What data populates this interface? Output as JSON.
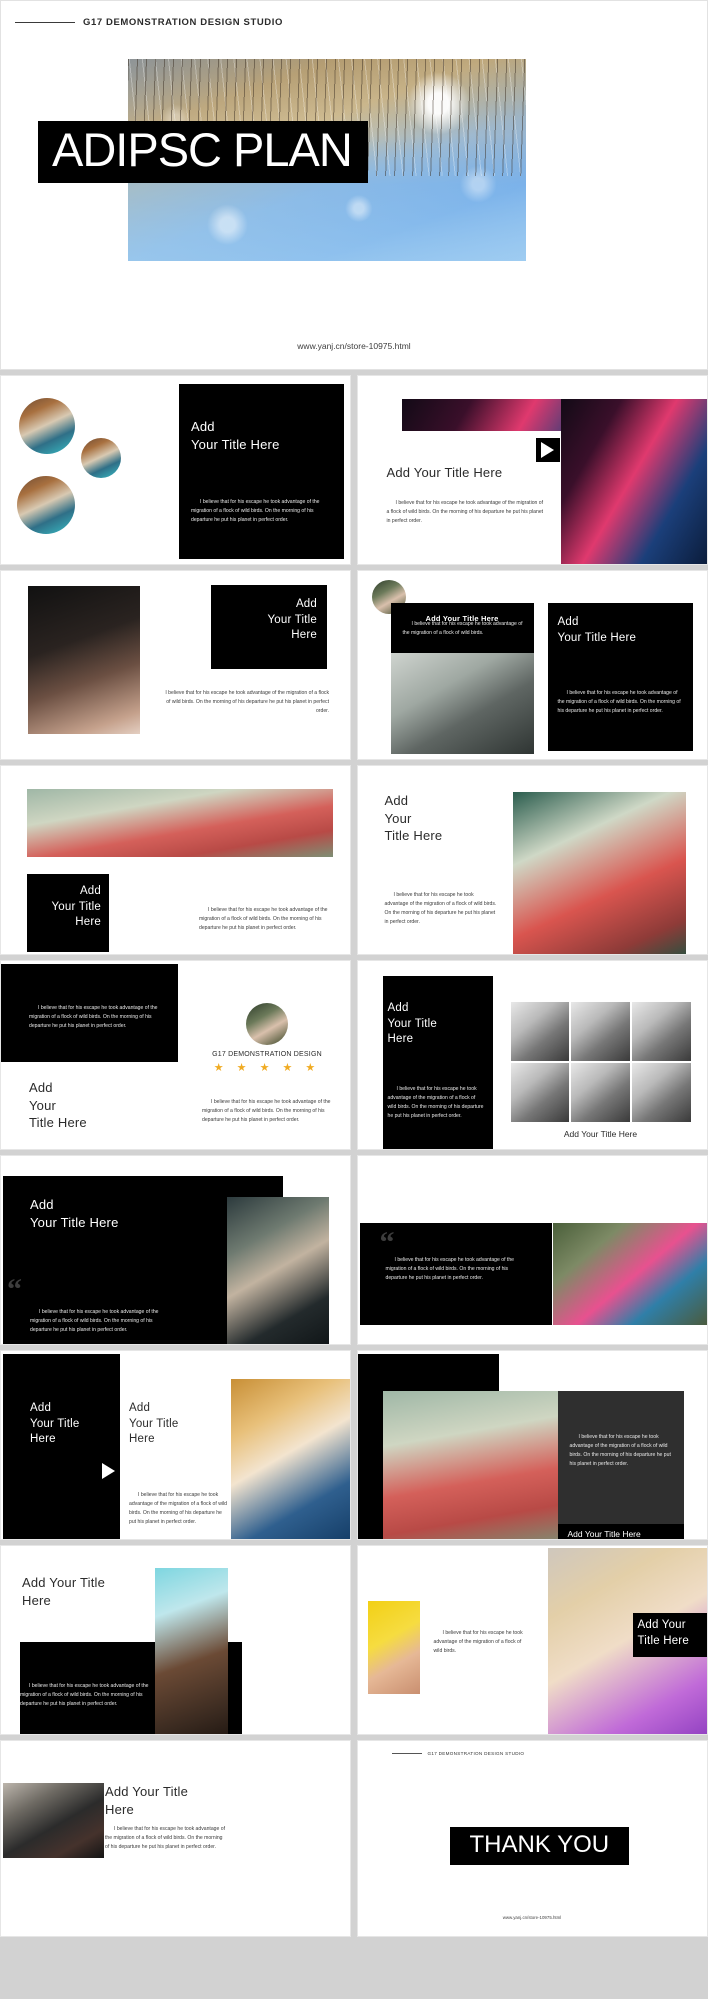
{
  "cover": {
    "brand": "G17 DEMONSTRATION  DESIGN STUDIO",
    "title": "ADIPSC PLAN",
    "url": "www.yanj.cn/store-10975.html"
  },
  "common": {
    "title_full": "Add Your Title Here",
    "title_line1": "Add",
    "title_line2": "Your Title Here",
    "title_l1": "Add",
    "title_l2": "Your",
    "title_l3": "Title Here",
    "body_full": "I believe that for his escape he took advantage of the migration of a flock of wild birds. On the morning of his departure he put his planet in perfect order.",
    "body_short": "I believe that for his escape he took advantage of the  migration of a flock of wild birds.",
    "quote_glyph": "“",
    "play_icon": "play-icon"
  },
  "slides": [
    {
      "id": "circles-photos",
      "title_line1": "Add",
      "title_line2": "Your Title Here",
      "body": "I believe that for his escape he took advantage of the migration of a flock of wild birds. On the morning of his departure he put his planet in perfect order."
    },
    {
      "id": "video-banner",
      "title": "Add Your Title Here",
      "body": "I believe that for his escape he took advantage of the migration of a flock of wild birds. On the morning of his departure he put his planet in perfect order."
    },
    {
      "id": "dark-portrait-right-title",
      "title_l1": "Add",
      "title_l2": "Your Title",
      "title_l3": "Here",
      "body": "I believe that for his escape he took advantage of the migration of a flock of wild birds. On the morning of his departure he put his planet in perfect order."
    },
    {
      "id": "avatar-card-street",
      "card_title": "Add Your Title Here",
      "card_body": "I believe that for his escape he took advantage of the  migration of a flock of wild birds.",
      "title_line1": "Add",
      "title_line2": "Your Title Here",
      "body": "I believe that for his escape he took advantage of the migration of a flock of wild birds. On the morning of his departure he put his planet in perfect order."
    },
    {
      "id": "wide-banner-umbrella",
      "title_l1": "Add",
      "title_l2": "Your Title",
      "title_l3": "Here",
      "body": "I believe that for his escape he took advantage of the migration of a flock of wild birds. On the morning of his departure he put his planet in perfect order."
    },
    {
      "id": "title-left-photo-right",
      "title_l1": "Add",
      "title_l2": "Your",
      "title_l3": "Title Here",
      "body": "I believe that for his escape he took advantage of the migration of a flock of wild birds. On the morning of his departure he put his planet in perfect order."
    },
    {
      "id": "testimonial-rating",
      "quote_body": "I believe that for his escape he took advantage of the migration of a flock of wild birds. On the morning of his departure he put his planet in perfect order.",
      "title_l1": "Add",
      "title_l2": "Your",
      "title_l3": "Title Here",
      "person_name": "G17 DEMONSTRATION DESIGN",
      "stars": "★ ★ ★ ★ ★",
      "star_count": 5,
      "body": "I believe that for his escape he took advantage of the migration of a flock of wild birds. On the morning of his departure he put his planet in perfect order."
    },
    {
      "id": "photo-grid-six",
      "title_l1": "Add",
      "title_l2": "Your Title",
      "title_l3": "Here",
      "body": "I believe that for his escape he took advantage of the migration of a flock of wild birds. On the morning of his departure he put his planet in perfect order.",
      "caption": "Add Your Title Here"
    },
    {
      "id": "quote-dark-rider",
      "title_line1": "Add",
      "title_line2": "Your Title Here",
      "body": "I believe that for his escape he took advantage of the migration of a flock of wild birds. On the morning of his departure he put his planet in perfect order."
    },
    {
      "id": "quote-band-scarf",
      "body": "I believe that for his escape he took advantage of the migration of a flock of wild birds. On the morning of his departure he put his planet in perfect order."
    },
    {
      "id": "two-title-play-bride",
      "title_a_l1": "Add",
      "title_a_l2": "Your Title",
      "title_a_l3": "Here",
      "title_b_l1": "Add",
      "title_b_l2": "Your Title",
      "title_b_l3": "Here",
      "body": "I believe that for his escape he took advantage of the migration of a flock of wild birds. On the morning of his departure he put his planet in perfect order."
    },
    {
      "id": "umbrella-dark-panel",
      "body": "I believe that for his escape he took advantage of the migration of a flock of wild birds. On the morning of his departure he put his planet in perfect order.",
      "caption": "Add Your Title Here"
    },
    {
      "id": "curly-hair-banner",
      "title_line1": "Add Your Title",
      "title_line2": "Here",
      "body": "I believe that for his escape he took advantage of the migration of a flock of wild birds. On the morning of his departure he put his planet in perfect order."
    },
    {
      "id": "two-portraits-caption",
      "body": "I believe that for his escape he took advantage of the migration of a flock of wild birds.",
      "title_l1": "Add Your",
      "title_l2": "Title Here"
    },
    {
      "id": "car-portrait-text",
      "title_line1": "Add Your Title",
      "title_line2": "Here",
      "body": "I believe that for his escape he took advantage of the migration of a flock of wild birds. On the morning of his departure he put his planet in perfect order."
    },
    {
      "id": "thank-you",
      "brand": "G17 DEMONSTRATION  DESIGN STUDIO",
      "heading": "THANK YOU",
      "url": "www.yanj.cn/store-10975.html"
    }
  ],
  "colors": {
    "accent_black": "#000000",
    "star_gold": "#f0ab22",
    "page_bg": "#d2d2d2",
    "slide_bg": "#ffffff"
  }
}
